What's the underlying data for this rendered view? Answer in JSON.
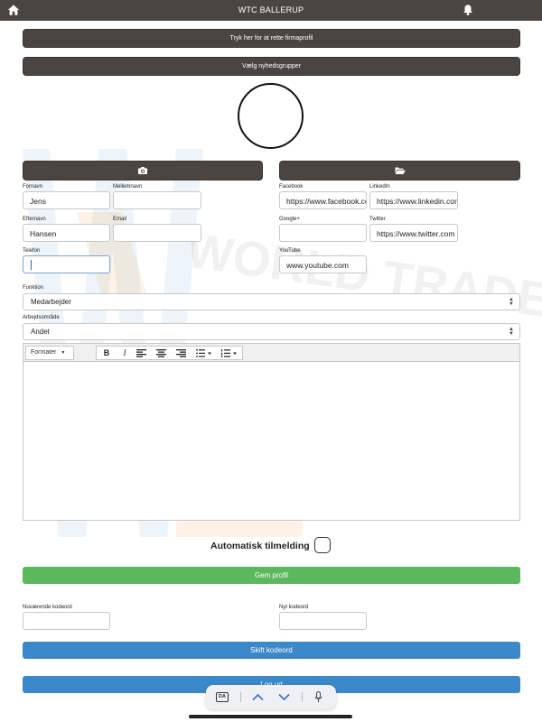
{
  "header": {
    "title": "WTC BALLERUP"
  },
  "buttons": {
    "company_profile": "Tryk her for at rette firmaprofil",
    "newsgroups": "Vælg nyhedsgrupper",
    "save_profile": "Gem profil",
    "change_password": "Skift kodeord",
    "logout": "Log ud"
  },
  "form": {
    "fornavn": {
      "label": "Fornavn",
      "value": "Jens"
    },
    "mellemnavn": {
      "label": "Mellemnavn",
      "value": ""
    },
    "efternavn": {
      "label": "Efternavn",
      "value": "Hansen"
    },
    "email": {
      "label": "Email",
      "value": ""
    },
    "telefon": {
      "label": "Telefon",
      "value": ""
    },
    "facebook": {
      "label": "Facebook",
      "value": "https://www.facebook.com"
    },
    "linkedin": {
      "label": "LinkedIn",
      "value": "https://www.linkedin.com"
    },
    "googleplus": {
      "label": "Google+",
      "value": ""
    },
    "twitter": {
      "label": "Twitter",
      "value": "https://www.twitter.com"
    },
    "youtube": {
      "label": "YouTube",
      "value": "www.youtube.com"
    }
  },
  "selects": {
    "funktion": {
      "label": "Funktion",
      "value": "Medarbejder"
    },
    "arbejdsomraade": {
      "label": "Arbejdsområde",
      "value": "Andet"
    }
  },
  "editor": {
    "formats_label": "Formater",
    "bold": "B",
    "italic": "I"
  },
  "auto_signup": {
    "label": "Automatisk tilmelding"
  },
  "password": {
    "current_label": "Nuværende kodeord",
    "new_label": "Nyt kodeord"
  },
  "keyboard": {
    "lang": "DA"
  },
  "colors": {
    "topbar": "#4a4541",
    "dark_button": "#4a4541",
    "save": "#5cb85c",
    "blue": "#3a87c9"
  }
}
